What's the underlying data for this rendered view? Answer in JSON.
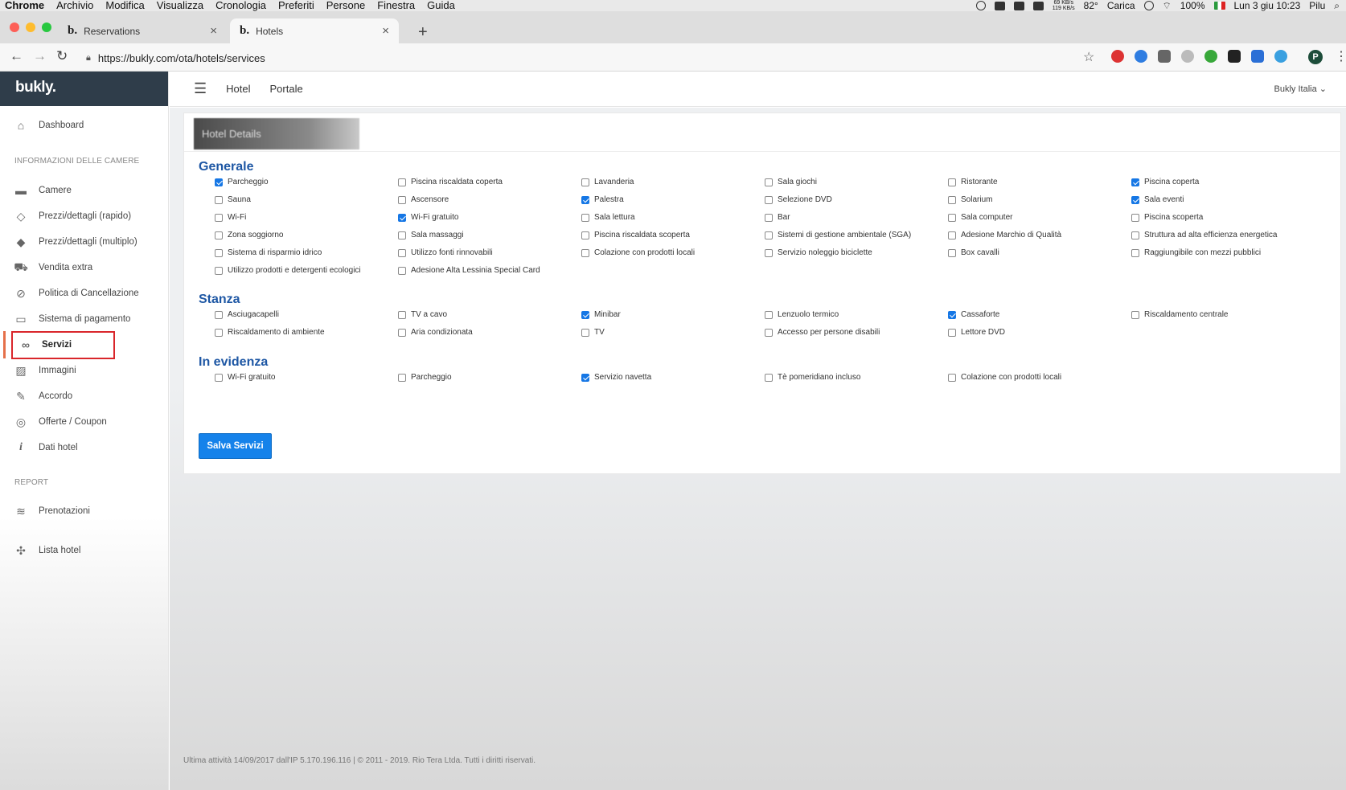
{
  "menubar": {
    "app": "Chrome",
    "items": [
      "Archivio",
      "Modifica",
      "Visualizza",
      "Cronologia",
      "Preferiti",
      "Persone",
      "Finestra",
      "Guida"
    ],
    "net_up": "69 KB/s",
    "net_down": "119 KB/s",
    "temp": "82°",
    "charging": "Carica",
    "battery": "100%",
    "datetime": "Lun 3 giu 10:23",
    "user": "Pilu"
  },
  "tabs": [
    {
      "label": "Reservations",
      "favicon": "b."
    },
    {
      "label": "Hotels",
      "favicon": "b."
    }
  ],
  "address": {
    "url": "https://bukly.com/ota/hotels/services"
  },
  "profile_initial": "P",
  "brand": "bukly.",
  "topnav": {
    "links": [
      "Hotel",
      "Portale"
    ],
    "account": "Bukly Italia"
  },
  "sidebar": {
    "dashboard": "Dashboard",
    "section_rooms": "INFORMAZIONI DELLE CAMERE",
    "items": [
      "Camere",
      "Prezzi/dettagli (rapido)",
      "Prezzi/dettagli (multiplo)",
      "Vendita extra",
      "Politica di Cancellazione",
      "Sistema di pagamento",
      "Servizi",
      "Immagini",
      "Accordo",
      "Offerte / Coupon",
      "Dati hotel"
    ],
    "section_report": "REPORT",
    "report_items": [
      "Prenotazioni"
    ],
    "hotel_list": "Lista hotel"
  },
  "panel_title": "Hotel Details",
  "sections": {
    "generale": {
      "title": "Generale",
      "items": [
        {
          "label": "Parcheggio",
          "checked": true
        },
        {
          "label": "Piscina riscaldata coperta",
          "checked": false
        },
        {
          "label": "Lavanderia",
          "checked": false
        },
        {
          "label": "Sala giochi",
          "checked": false
        },
        {
          "label": "Ristorante",
          "checked": false
        },
        {
          "label": "Piscina coperta",
          "checked": true
        },
        {
          "label": "Sauna",
          "checked": false
        },
        {
          "label": "Ascensore",
          "checked": false
        },
        {
          "label": "Palestra",
          "checked": true
        },
        {
          "label": "Selezione DVD",
          "checked": false
        },
        {
          "label": "Solarium",
          "checked": false
        },
        {
          "label": "Sala eventi",
          "checked": true
        },
        {
          "label": "Wi-Fi",
          "checked": false
        },
        {
          "label": "Wi-Fi gratuito",
          "checked": true
        },
        {
          "label": "Sala lettura",
          "checked": false
        },
        {
          "label": "Bar",
          "checked": false
        },
        {
          "label": "Sala computer",
          "checked": false
        },
        {
          "label": "Piscina scoperta",
          "checked": false
        },
        {
          "label": "Zona soggiorno",
          "checked": false
        },
        {
          "label": "Sala massaggi",
          "checked": false
        },
        {
          "label": "Piscina riscaldata scoperta",
          "checked": false
        },
        {
          "label": "Sistemi di gestione ambientale (SGA)",
          "checked": false
        },
        {
          "label": "Adesione Marchio di Qualità",
          "checked": false
        },
        {
          "label": "Struttura ad alta efficienza energetica",
          "checked": false
        },
        {
          "label": "Sistema di risparmio idrico",
          "checked": false
        },
        {
          "label": "Utilizzo fonti rinnovabili",
          "checked": false
        },
        {
          "label": "Colazione con prodotti locali",
          "checked": false
        },
        {
          "label": "Servizio noleggio biciclette",
          "checked": false
        },
        {
          "label": "Box cavalli",
          "checked": false
        },
        {
          "label": "Raggiungibile con mezzi pubblici",
          "checked": false
        },
        {
          "label": "Utilizzo prodotti e detergenti ecologici",
          "checked": false
        },
        {
          "label": "Adesione Alta Lessinia Special Card",
          "checked": false
        }
      ]
    },
    "stanza": {
      "title": "Stanza",
      "items": [
        {
          "label": "Asciugacapelli",
          "checked": false
        },
        {
          "label": "TV a cavo",
          "checked": false
        },
        {
          "label": "Minibar",
          "checked": true
        },
        {
          "label": "Lenzuolo termico",
          "checked": false
        },
        {
          "label": "Cassaforte",
          "checked": true
        },
        {
          "label": "Riscaldamento centrale",
          "checked": false
        },
        {
          "label": "Riscaldamento di ambiente",
          "checked": false
        },
        {
          "label": "Aria condizionata",
          "checked": false
        },
        {
          "label": "TV",
          "checked": false
        },
        {
          "label": "Accesso per persone disabili",
          "checked": false
        },
        {
          "label": "Lettore DVD",
          "checked": false
        }
      ]
    },
    "evidenza": {
      "title": "In evidenza",
      "items": [
        {
          "label": "Wi-Fi gratuito",
          "checked": false
        },
        {
          "label": "Parcheggio",
          "checked": false
        },
        {
          "label": "Servizio navetta",
          "checked": true
        },
        {
          "label": "Tè pomeridiano incluso",
          "checked": false
        },
        {
          "label": "Colazione con prodotti locali",
          "checked": false
        }
      ]
    }
  },
  "save_label": "Salva Servizi",
  "footer": "Ultima attività 14/09/2017 dall'IP 5.170.196.116 | © 2011 - 2019. Rio Tera Ltda. Tutti i diritti riservati.",
  "colors": {
    "accent": "#1582ea",
    "section_title": "#1e57a4",
    "sidebar_brand_bg": "#2f3d4a",
    "active_marker": "#e5704a",
    "highlight_box": "#d9262b"
  }
}
